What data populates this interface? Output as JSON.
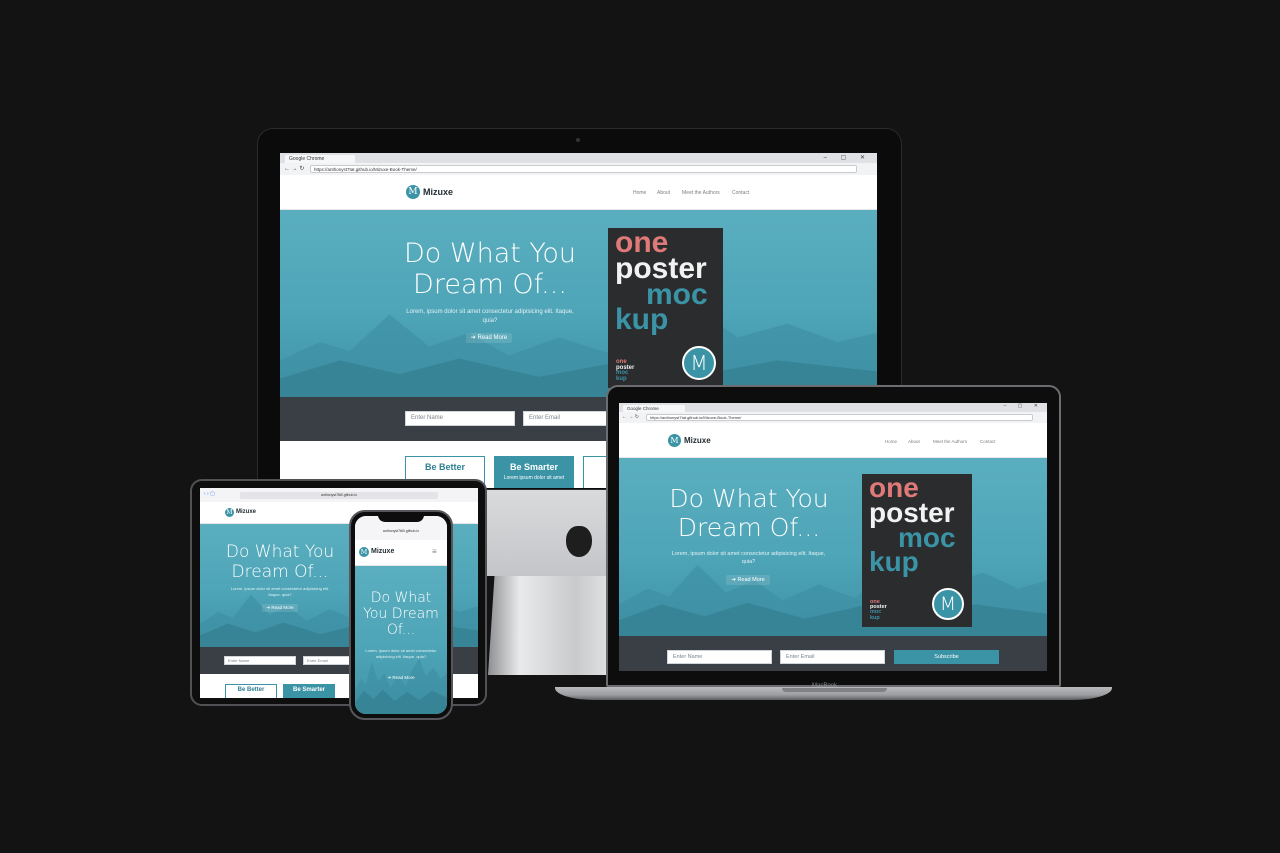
{
  "browser": {
    "tab_title": "Google Chrome",
    "url_imac": "https://anthonyst7tat.github.io/Mizuxe-Book-Theme/",
    "url_macbook": "https://anthonyst7tat.github.io/Mizuxe-Book-Theme/",
    "url_mobile": "anthonyst7t60.github.io"
  },
  "site": {
    "brand": "Mizuxe",
    "logo_letter": "M",
    "nav": [
      "Home",
      "About",
      "Meet the Authors",
      "Contact"
    ],
    "hero_title_line1": "Do What You",
    "hero_title_line2": "Dream Of...",
    "hero_title_phone_1": "Do What",
    "hero_title_phone_2": "You Dream",
    "hero_title_phone_3": "Of...",
    "hero_text": "Lorem, ipsum dolor sit amet consectetur adipisicing elit. Itaque, quia?",
    "read_more": "Read More",
    "name_placeholder": "Enter Name",
    "email_placeholder": "Enter Email",
    "subscribe": "Subscribe",
    "cards": [
      "Be Better",
      "Be Smarter"
    ],
    "card_text": "Lorem ipsum dolor sit amet"
  },
  "poster": {
    "line1": "one",
    "line2": "poster",
    "line3": "moc",
    "line4": "kup",
    "mini1": "one",
    "mini2": "poster",
    "mini3": "moc",
    "mini4": "kup",
    "badge": "M"
  },
  "device_labels": {
    "macbook": "MacBook"
  },
  "colors": {
    "accent": "#3b93a6",
    "hero": "#4ea5b7",
    "form_band": "#3a3f45",
    "poster_bg": "#2b2c2e",
    "poster_red": "#e07a78",
    "background": "#131313"
  }
}
